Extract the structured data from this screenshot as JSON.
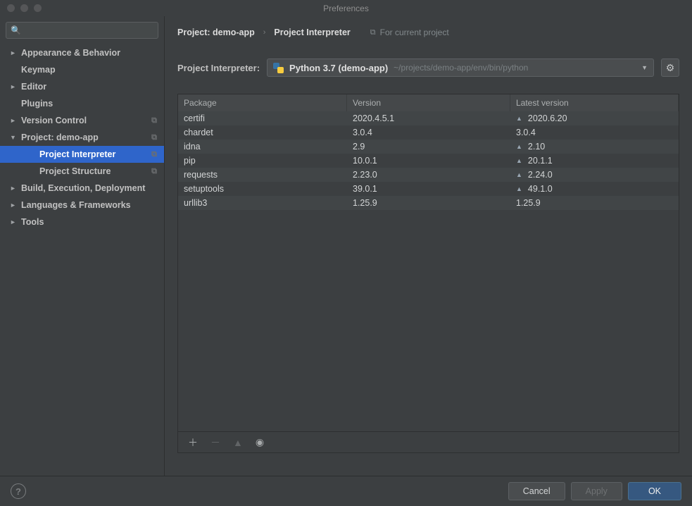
{
  "window": {
    "title": "Preferences"
  },
  "search": {
    "placeholder": ""
  },
  "sidebar": {
    "items": [
      {
        "label": "Appearance & Behavior",
        "arrow": "►",
        "copy": false
      },
      {
        "label": "Keymap",
        "arrow": "",
        "copy": false
      },
      {
        "label": "Editor",
        "arrow": "►",
        "copy": false
      },
      {
        "label": "Plugins",
        "arrow": "",
        "copy": false
      },
      {
        "label": "Version Control",
        "arrow": "►",
        "copy": true
      },
      {
        "label": "Project: demo-app",
        "arrow": "▼",
        "copy": true
      },
      {
        "label": "Project Interpreter",
        "arrow": "",
        "copy": true,
        "sub": true,
        "selected": true
      },
      {
        "label": "Project Structure",
        "arrow": "",
        "copy": true,
        "sub": true
      },
      {
        "label": "Build, Execution, Deployment",
        "arrow": "►",
        "copy": false
      },
      {
        "label": "Languages & Frameworks",
        "arrow": "►",
        "copy": false
      },
      {
        "label": "Tools",
        "arrow": "►",
        "copy": false
      }
    ]
  },
  "breadcrumb": {
    "part1": "Project: demo-app",
    "sep": "›",
    "part2": "Project Interpreter",
    "for_project": "For current project"
  },
  "interpreter": {
    "label": "Project Interpreter:",
    "name": "Python 3.7 (demo-app)",
    "path": "~/projects/demo-app/env/bin/python"
  },
  "packages": {
    "headers": {
      "c1": "Package",
      "c2": "Version",
      "c3": "Latest version"
    },
    "rows": [
      {
        "name": "certifi",
        "version": "2020.4.5.1",
        "latest": "2020.6.20",
        "upgrade": true
      },
      {
        "name": "chardet",
        "version": "3.0.4",
        "latest": "3.0.4",
        "upgrade": false
      },
      {
        "name": "idna",
        "version": "2.9",
        "latest": "2.10",
        "upgrade": true
      },
      {
        "name": "pip",
        "version": "10.0.1",
        "latest": "20.1.1",
        "upgrade": true
      },
      {
        "name": "requests",
        "version": "2.23.0",
        "latest": "2.24.0",
        "upgrade": true
      },
      {
        "name": "setuptools",
        "version": "39.0.1",
        "latest": "49.1.0",
        "upgrade": true
      },
      {
        "name": "urllib3",
        "version": "1.25.9",
        "latest": "1.25.9",
        "upgrade": false
      }
    ]
  },
  "footer": {
    "cancel": "Cancel",
    "apply": "Apply",
    "ok": "OK"
  }
}
